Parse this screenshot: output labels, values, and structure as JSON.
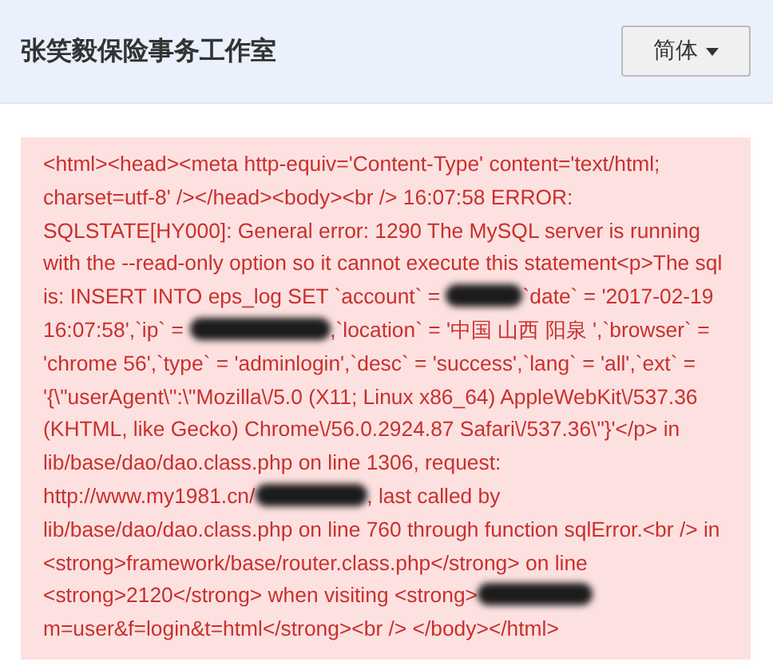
{
  "header": {
    "title": "张笑毅保险事务工作室",
    "language_button": {
      "label": "简体"
    }
  },
  "error_message": {
    "segments": [
      {
        "kind": "text",
        "text": "<html><head><meta http-equiv='Content-Type' content='text/html; charset=utf-8' /></head><body><br /> 16:07:58 ERROR: SQLSTATE[HY000]: General error: 1290 The MySQL server is running with the --read-only option so it cannot execute this statement<p>The sql is: INSERT INTO eps_log SET `account` = "
      },
      {
        "kind": "redacted"
      },
      {
        "kind": "text",
        "text": "`date` = '2017-02-19 16:07:58',`ip` = "
      },
      {
        "kind": "redacted"
      },
      {
        "kind": "text",
        "text": ",`location` = '中国 山西 阳泉 ',`browser` = 'chrome 56',`type` = 'adminlogin',`desc` = 'success',`lang` = 'all',`ext` = '{\\\"userAgent\\\":\\\"Mozilla\\/5.0 (X11; Linux x86_64) AppleWebKit\\/537.36 (KHTML, like Gecko) Chrome\\/56.0.2924.87 Safari\\/537.36\\\"}'</p> in lib/base/dao/dao.class.php on line 1306, request: http://www.my1981.cn/"
      },
      {
        "kind": "redacted"
      },
      {
        "kind": "text",
        "text": ", last called by lib/base/dao/dao.class.php on line 760 through function sqlError.<br /> in <strong>framework/base/router.class.php</strong> on line <strong>2120</strong> when visiting <strong>"
      },
      {
        "kind": "redacted"
      },
      {
        "kind": "text",
        "text": "m=user&f=login&t=html</strong><br /> </body></html>"
      }
    ]
  }
}
